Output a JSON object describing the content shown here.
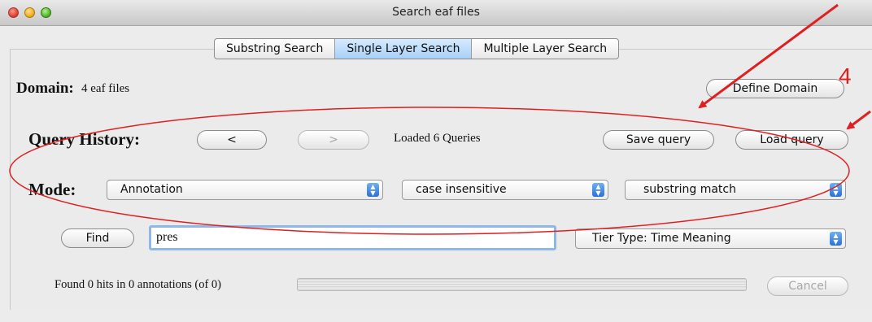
{
  "window": {
    "title": "Search eaf files"
  },
  "tabs": [
    {
      "label": "Substring Search",
      "active": false
    },
    {
      "label": "Single Layer Search",
      "active": true
    },
    {
      "label": "Multiple Layer Search",
      "active": false
    }
  ],
  "domain": {
    "label": "Domain:",
    "value": "4 eaf files",
    "define_button": "Define Domain"
  },
  "query_history": {
    "label": "Query History:",
    "prev_button": "<",
    "next_button": ">",
    "status": "Loaded 6 Queries",
    "save_button": "Save query",
    "load_button": "Load query"
  },
  "mode": {
    "label": "Mode:",
    "type_select": "Annotation",
    "case_select": "case insensitive",
    "match_select": "substring match"
  },
  "search": {
    "find_button": "Find",
    "query_value": "pres",
    "tier_select": "Tier Type: Time Meaning"
  },
  "status_bar": {
    "text": "Found 0 hits in 0 annotations (of 0)",
    "cancel_button": "Cancel"
  },
  "annotation": {
    "number": "4",
    "color": "#e02020"
  },
  "colors": {
    "active_tab": "#a7d0f7",
    "focus_ring": "#8fb8ea",
    "select_arrow": "#2a6fd8"
  }
}
